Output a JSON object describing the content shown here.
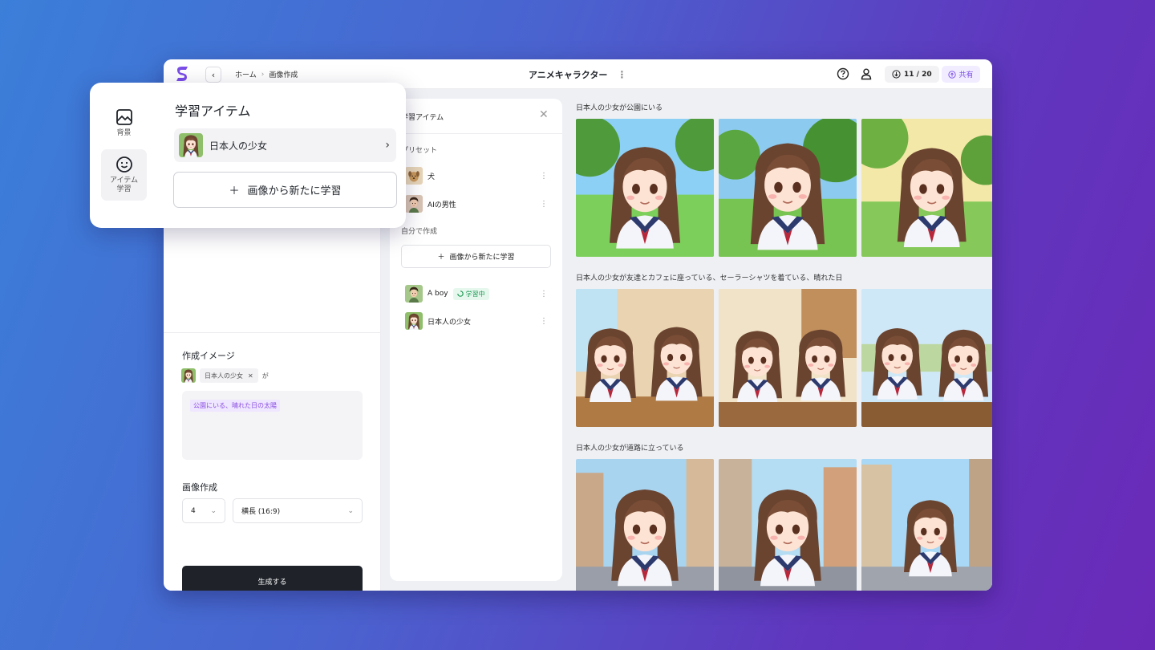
{
  "header": {
    "breadcrumb": [
      "ホーム",
      "画像作成"
    ],
    "title": "アニメキャラクター",
    "credits": "11 / 20",
    "share": "共有",
    "icons": [
      "help-icon",
      "user-icon",
      "download-icon",
      "share-icon"
    ]
  },
  "left_panel": {
    "create_image_label": "作成イメージ",
    "chip_label": "日本人の少女",
    "chip_particle": "が",
    "prompt_tag": "公園にいる、晴れた日の太陽",
    "image_create_label": "画像作成",
    "count_value": "4",
    "ratio_value": "横長 (16:9)",
    "generate_label": "生成する"
  },
  "learn_panel": {
    "title": "学習アイテム",
    "preset_label": "プリセット",
    "presets": [
      {
        "label": "犬"
      },
      {
        "label": "AIの男性"
      }
    ],
    "custom_label": "自分で作成",
    "add_label": "画像から新たに学習",
    "custom_items": [
      {
        "label": "A boy",
        "badge": "学習中"
      },
      {
        "label": "日本人の少女"
      }
    ]
  },
  "gallery": {
    "captions": [
      "日本人の少女が公園にいる",
      "日本人の少女が友達とカフェに座っている、セーラーシャツを着ている、晴れた日",
      "日本人の少女が道路に立っている"
    ]
  },
  "popover": {
    "nav": [
      {
        "label": "背景"
      },
      {
        "label": "アイテム学習"
      }
    ],
    "title": "学習アイテム",
    "item_label": "日本人の少女",
    "add_label": "画像から新たに学習"
  },
  "colors": {
    "accent": "#7a4de8",
    "primary_button": "#1f2329",
    "learning_badge": "#1f9a54"
  }
}
